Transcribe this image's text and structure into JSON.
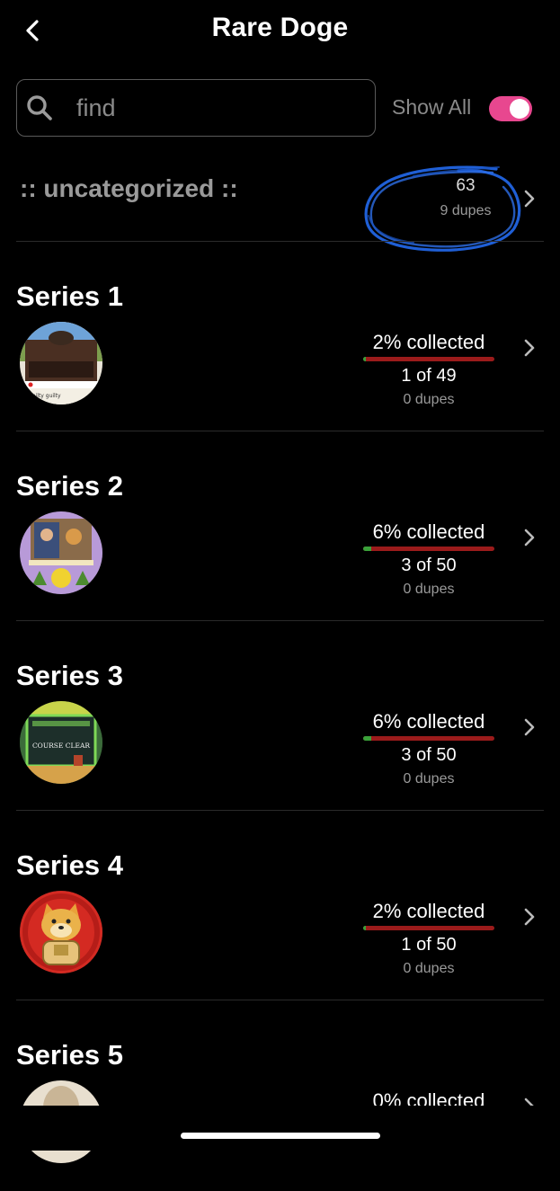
{
  "header": {
    "title": "Rare Doge",
    "back_icon": "chevron-left-icon"
  },
  "search": {
    "placeholder": "find",
    "value": "",
    "icon": "search-icon"
  },
  "show_all": {
    "label": "Show All",
    "enabled": true,
    "color": "#e8478f"
  },
  "uncategorized": {
    "label": ":: uncategorized ::",
    "count": "63",
    "dupes": "9 dupes"
  },
  "series": [
    {
      "title": "Series 1",
      "collected": "2% collected",
      "fraction": 0.02,
      "count": "1 of 49",
      "dupes": "0 dupes"
    },
    {
      "title": "Series 2",
      "collected": "6% collected",
      "fraction": 0.06,
      "count": "3 of 50",
      "dupes": "0 dupes"
    },
    {
      "title": "Series 3",
      "collected": "6% collected",
      "fraction": 0.06,
      "count": "3 of 50",
      "dupes": "0 dupes"
    },
    {
      "title": "Series 4",
      "collected": "2% collected",
      "fraction": 0.02,
      "count": "1 of 50",
      "dupes": "0 dupes"
    },
    {
      "title": "Series 5",
      "collected": "0% collected",
      "fraction": 0.0,
      "count": "",
      "dupes": ""
    }
  ],
  "colors": {
    "progress_track": "#9b1b1b",
    "progress_fill": "#3aa13a",
    "annotation": "#1f5fd6"
  }
}
